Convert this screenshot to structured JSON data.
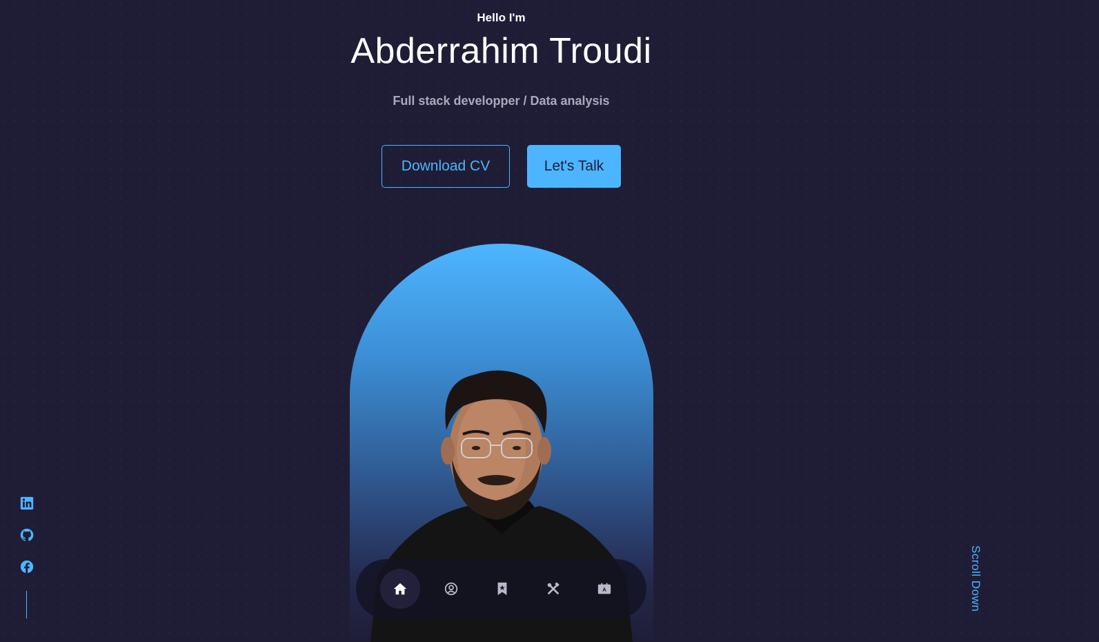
{
  "hero": {
    "greeting": "Hello I'm",
    "name": "Abderrahim Troudi",
    "role": "Full stack developper / Data analysis"
  },
  "buttons": {
    "download_cv": "Download CV",
    "lets_talk": "Let's Talk"
  },
  "nav": {
    "items": [
      {
        "icon": "home-icon",
        "active": true
      },
      {
        "icon": "user-circle-icon",
        "active": false
      },
      {
        "icon": "bookmark-icon",
        "active": false
      },
      {
        "icon": "tools-icon",
        "active": false
      },
      {
        "icon": "contact-card-icon",
        "active": false
      }
    ]
  },
  "socials": [
    {
      "icon": "linkedin-icon"
    },
    {
      "icon": "github-icon"
    },
    {
      "icon": "facebook-icon"
    }
  ],
  "scroll_down": "Scroll Down",
  "colors": {
    "background": "#1f1d36",
    "accent": "#4db5ff",
    "muted_text": "#a9a9bd",
    "nav_bg": "#141222"
  }
}
